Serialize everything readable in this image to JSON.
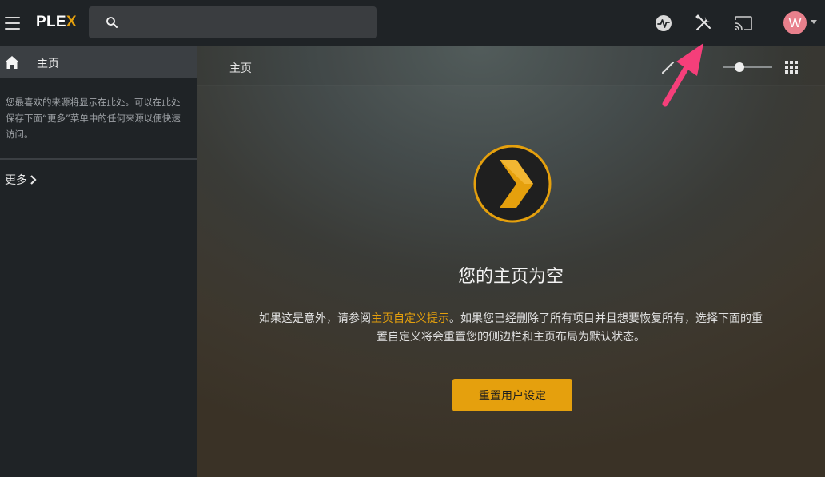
{
  "header": {
    "logo_main": "PLE",
    "logo_accent": "X",
    "search": {
      "value": "",
      "placeholder": ""
    },
    "avatar_initial": "W"
  },
  "sidebar": {
    "home_label": "主页",
    "hint": "您最喜欢的来源将显示在此处。可以在此处保存下面“更多”菜单中的任何来源以便快速访问。",
    "more_label": "更多"
  },
  "main": {
    "title": "主页",
    "empty_title": "您的主页为空",
    "empty_text_before": "如果这是意外，请参阅",
    "empty_text_link": "主页自定义提示",
    "empty_text_after": "。如果您已经删除了所有项目并且想要恢复所有，选择下面的重置自定义将会重置您的侧边栏和主页布局为默认状态。",
    "reset_button": "重置用户设定",
    "size_slider_value": 0.3
  },
  "icons": {
    "menu": "hamburger-menu-icon",
    "search": "search-icon",
    "activity": "activity-icon",
    "tools": "settings-tools-icon",
    "cast": "cast-icon",
    "home": "home-icon",
    "more_chevron": "chevron-right-icon",
    "edit": "pencil-icon",
    "grid": "grid-view-icon",
    "empty": "plex-chevron-logo-icon",
    "annotation": "pink-arrow-annotation-icon"
  },
  "colors": {
    "accent": "#e5a00d",
    "background": "#1f2326",
    "sidebar_selected": "#3b3f43",
    "avatar": "#e8808c",
    "annotation_arrow": "#f53f7a"
  }
}
